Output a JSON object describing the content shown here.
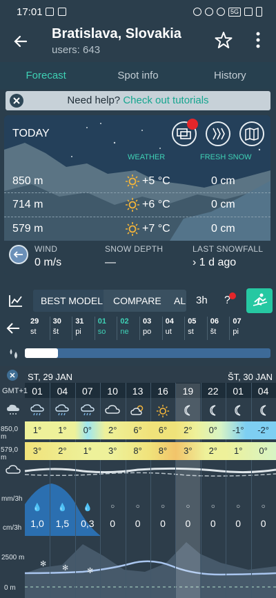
{
  "status_bar": {
    "time": "17:01",
    "network": "5G"
  },
  "header": {
    "title": "Bratislava, Slovakia",
    "users": "users: 643"
  },
  "tabs": [
    "Forecast",
    "Spot info",
    "History"
  ],
  "help": {
    "text": "Need help?",
    "link": "Check out tutorials"
  },
  "today": {
    "label": "TODAY",
    "weather_header": "WEATHER",
    "snow_header": "FRESH SNOW",
    "rows": [
      {
        "alt": "850 m",
        "temp": "+5 °C",
        "snow": "0 cm"
      },
      {
        "alt": "714 m",
        "temp": "+6 °C",
        "snow": "0 cm"
      },
      {
        "alt": "579 m",
        "temp": "+7 °C",
        "snow": "0 cm"
      }
    ],
    "wind_label": "WIND",
    "wind_value": "0 m/s",
    "depth_label": "SNOW DEPTH",
    "depth_value": "—",
    "last_label": "LAST SNOWFALL",
    "last_value": "› 1 d ago"
  },
  "toolbar": {
    "best": "BEST MODEL",
    "compare": "COMPARE",
    "all": "ALL",
    "interval": "3h",
    "help": "?"
  },
  "days": [
    {
      "n": "29",
      "d": "st",
      "green": false
    },
    {
      "n": "30",
      "d": "št",
      "green": false
    },
    {
      "n": "31",
      "d": "pi",
      "green": false
    },
    {
      "n": "01",
      "d": "so",
      "green": true
    },
    {
      "n": "02",
      "d": "ne",
      "green": true
    },
    {
      "n": "03",
      "d": "po",
      "green": false
    },
    {
      "n": "04",
      "d": "ut",
      "green": false
    },
    {
      "n": "05",
      "d": "st",
      "green": false
    },
    {
      "n": "06",
      "d": "št",
      "green": false
    },
    {
      "n": "07",
      "d": "pi",
      "green": false
    }
  ],
  "grid": {
    "tz": "GMT+1",
    "date1": "ST, 29 JAN",
    "date2": "ŠT, 30 JAN",
    "hours": [
      "01",
      "04",
      "07",
      "10",
      "13",
      "16",
      "19",
      "22",
      "01",
      "04"
    ],
    "weather": [
      "snow-rain",
      "snow-rain",
      "snow-rain",
      "cloud",
      "sun-cloud",
      "sun",
      "moon",
      "moon",
      "moon",
      "moon"
    ],
    "temp_850": [
      "1°",
      "1°",
      "0°",
      "2°",
      "6°",
      "6°",
      "2°",
      "0°",
      "-1°",
      "-2°"
    ],
    "temp_579": [
      "3°",
      "2°",
      "1°",
      "3°",
      "8°",
      "8°",
      "3°",
      "2°",
      "1°",
      "0°"
    ],
    "rain": [
      "1,0",
      "1,5",
      "0,3",
      "0",
      "0",
      "0",
      "0",
      "0",
      "0",
      "0"
    ],
    "row_labels": {
      "alt1": "850,0 m",
      "alt2": "579,0 m",
      "mm": "mm/3h",
      "cm": "cm/3h",
      "h1": "2500 m",
      "h2": "0 m"
    }
  },
  "colors": {
    "accent": "#3fd1b5",
    "alert": "#e3262a",
    "ski_button": "#26c8a2"
  }
}
